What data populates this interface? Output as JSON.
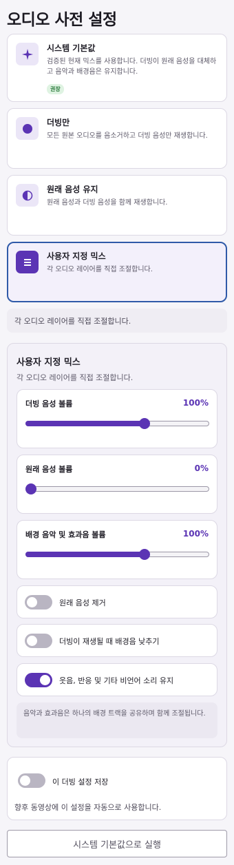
{
  "page": {
    "title": "오디오 사전 설정",
    "accent_color": "#5b34b4",
    "selected_border_color": "#2f5aa8"
  },
  "presets": [
    {
      "title": "시스템 기본값",
      "description": "검증된 현재 믹스를 사용합니다. 더빙이 원래 음성을 대체하고 음악과 배경음은 유지합니다.",
      "badge": "권장",
      "icon": "sparkle-icon",
      "selected": false
    },
    {
      "title": "더빙만",
      "description": "모든 원본 오디오를 음소거하고 더빙 음성만 재생합니다.",
      "icon": "filled-circle-icon",
      "selected": false
    },
    {
      "title": "원래 음성 유지",
      "description": "원래 음성과 더빙 음성을 함께 재생합니다.",
      "icon": "half-circle-icon",
      "selected": false
    },
    {
      "title": "사용자 지정 믹스",
      "description": "각 오디오 레이어를 직접 조절합니다.",
      "icon": "layers-icon",
      "selected": true
    }
  ],
  "info_strip": "각 오디오 레이어를 직접 조절합니다.",
  "custom_mix": {
    "title": "사용자 지정 믹스",
    "subtitle": "각 오디오 레이어를 직접 조절합니다.",
    "sliders": [
      {
        "label": "더빙 음성 볼륨",
        "value_text": "100%",
        "level": 0.65
      },
      {
        "label": "원래 음성 볼륨",
        "value_text": "0%",
        "level": 0
      },
      {
        "label": "배경 음악 및 효과음 볼륨",
        "value_text": "100%",
        "level": 0.65
      }
    ],
    "toggles": [
      {
        "label": "원래 음성 제거",
        "on": false
      },
      {
        "label": "더빙이 재생될 때 배경음 낮추기",
        "on": false
      },
      {
        "label": "웃음, 반응 및 기타 비언어 소리 유지",
        "on": true
      }
    ],
    "note": "음악과 효과음은 하나의 배경 트랙을 공유하며 함께 조절됩니다."
  },
  "save": {
    "label": "이 더빙 설정 저장",
    "on": false,
    "hint": "향후 동영상에 이 설정을 자동으로 사용합니다."
  },
  "run_button": "시스템 기본값으로 실행"
}
